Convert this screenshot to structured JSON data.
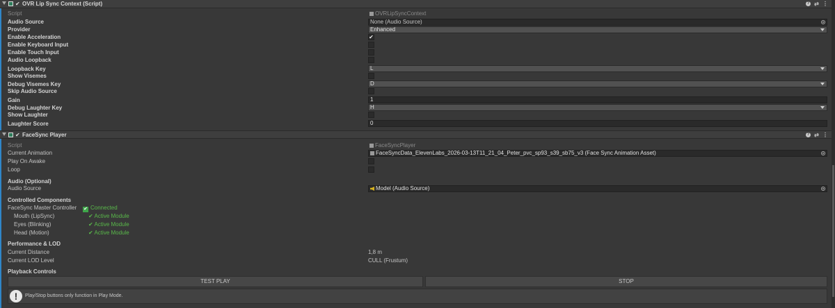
{
  "ovr": {
    "title": "OVR Lip Sync Context (Script)",
    "script_label": "Script",
    "script_value": "OVRLipSyncContext",
    "audio_source_label": "Audio Source",
    "audio_source_value": "None (Audio Source)",
    "provider_label": "Provider",
    "provider_value": "Enhanced",
    "enable_acceleration_label": "Enable Acceleration",
    "enable_acceleration_checked": true,
    "enable_keyboard_label": "Enable Keyboard Input",
    "enable_touch_label": "Enable Touch Input",
    "audio_loopback_label": "Audio Loopback",
    "loopback_key_label": "Loopback Key",
    "loopback_key_value": "L",
    "show_visemes_label": "Show Visemes",
    "debug_visemes_key_label": "Debug Visemes Key",
    "debug_visemes_key_value": "D",
    "skip_audio_source_label": "Skip Audio Source",
    "gain_label": "Gain",
    "gain_value": "1",
    "debug_laughter_key_label": "Debug Laughter Key",
    "debug_laughter_key_value": "H",
    "show_laughter_label": "Show Laughter",
    "laughter_score_label": "Laughter Score",
    "laughter_score_value": "0",
    "check_mark": "✔"
  },
  "facesync": {
    "title": "FaceSync Player",
    "script_label": "Script",
    "script_value": "FaceSyncPlayer",
    "current_animation_label": "Current Animation",
    "current_animation_value": "FaceSyncData_ElevenLabs_2026-03-13T11_21_04_Peter_pvc_sp93_s39_sb75_v3 (Face Sync Animation Asset)",
    "play_on_awake_label": "Play On Awake",
    "loop_label": "Loop",
    "audio_header": "Audio (Optional)",
    "audio_source_label": "Audio Source",
    "audio_source_value": "Model (Audio Source)",
    "controlled_header": "Controlled Components",
    "master_label": "FaceSync Master Controller",
    "master_status": "Connected",
    "modules": [
      {
        "label": "Mouth (LipSync)",
        "status": "Active Module"
      },
      {
        "label": "Eyes (Blinking)",
        "status": "Active Module"
      },
      {
        "label": "Head (Motion)",
        "status": "Active Module"
      }
    ],
    "perf_header": "Performance & LOD",
    "current_distance_label": "Current Distance",
    "current_distance_value": "1,8 m",
    "lod_label": "Current LOD Level",
    "lod_value": "CULL (Frustum)",
    "playback_header": "Playback Controls",
    "test_play_label": "TEST PLAY",
    "stop_label": "STOP",
    "help_text": "Play/Stop buttons only function in Play Mode.",
    "check_glyph": "✔"
  },
  "colors": {
    "accent": "#2f86c9",
    "green": "#59b84a",
    "speaker": "#d6b11f"
  }
}
